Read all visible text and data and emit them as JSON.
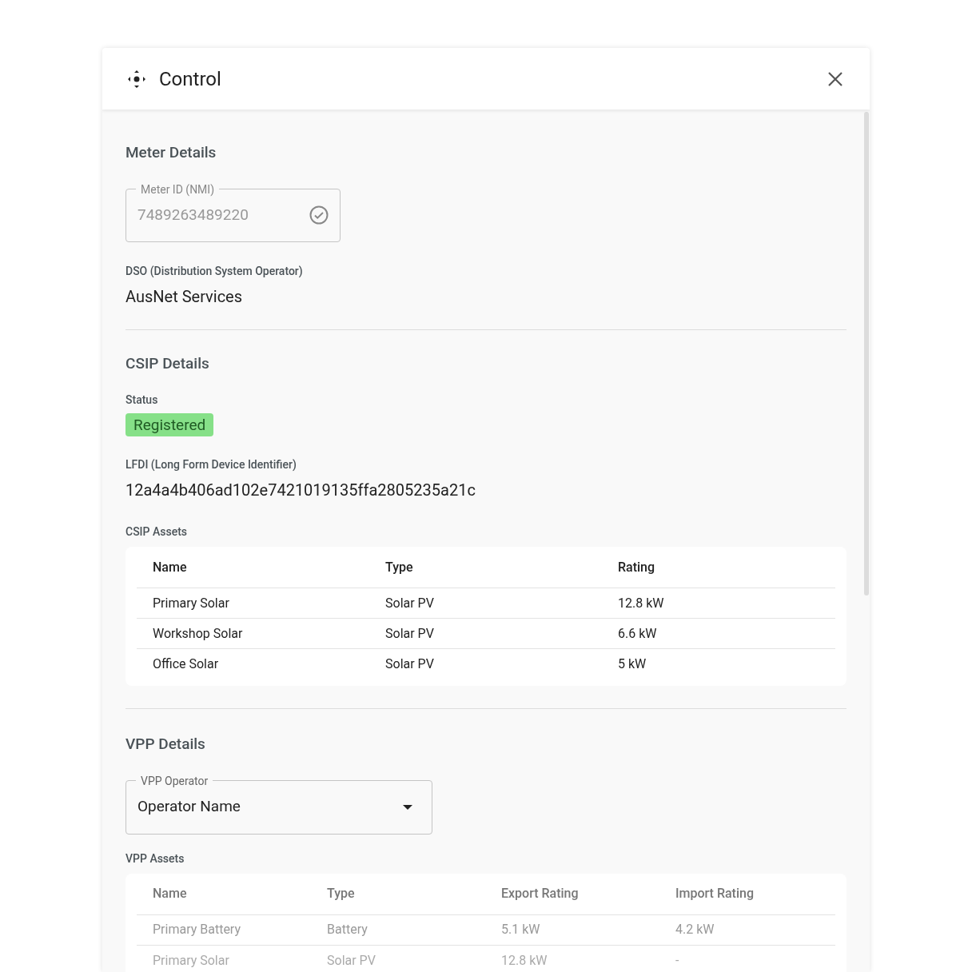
{
  "dialog": {
    "title": "Control"
  },
  "meter_details": {
    "heading": "Meter Details",
    "meter_id": {
      "label": "Meter ID (NMI)",
      "value": "7489263489220",
      "verified": true
    },
    "dso_label": "DSO (Distribution System Operator)",
    "dso_value": "AusNet Services"
  },
  "csip_details": {
    "heading": "CSIP Details",
    "status_label": "Status",
    "status": "Registered",
    "lfdi_label": "LFDI (Long Form Device Identifier)",
    "lfdi_value": "12a4a4b406ad102e7421019135ffa2805235a21c",
    "assets_label": "CSIP Assets",
    "table": {
      "columns": [
        "Name",
        "Type",
        "Rating"
      ],
      "rows": [
        [
          "Primary Solar",
          "Solar PV",
          "12.8 kW"
        ],
        [
          "Workshop Solar",
          "Solar PV",
          "6.6 kW"
        ],
        [
          "Office Solar",
          "Solar PV",
          "5 kW"
        ]
      ]
    }
  },
  "vpp_details": {
    "heading": "VPP Details",
    "operator": {
      "label": "VPP Operator",
      "value": "Operator Name"
    },
    "assets_label": "VPP Assets",
    "table": {
      "columns": [
        "Name",
        "Type",
        "Export Rating",
        "Import Rating"
      ],
      "rows": [
        [
          "Primary Battery",
          "Battery",
          "5.1 kW",
          "4.2 kW"
        ],
        [
          "Primary Solar",
          "Solar PV",
          "12.8 kW",
          "-"
        ]
      ]
    }
  }
}
